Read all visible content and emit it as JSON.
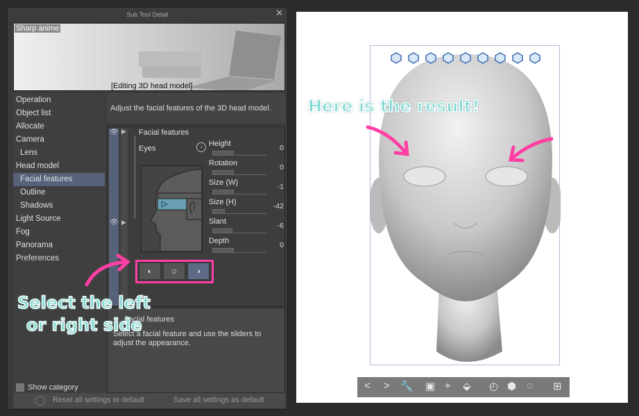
{
  "dialog": {
    "title": "Sub Tool Detail",
    "preset_name": "Sharp anime",
    "preview_caption": "[Editing 3D head model]"
  },
  "nav": {
    "items": [
      {
        "label": "Operation",
        "level": 0,
        "selected": false
      },
      {
        "label": "Object list",
        "level": 0,
        "selected": false
      },
      {
        "label": "Allocate",
        "level": 0,
        "selected": false
      },
      {
        "label": "Camera",
        "level": 0,
        "selected": false
      },
      {
        "label": "Lens",
        "level": 1,
        "selected": false
      },
      {
        "label": "Head model",
        "level": 0,
        "selected": false
      },
      {
        "label": "Facial features",
        "level": 1,
        "selected": true
      },
      {
        "label": "Outline",
        "level": 1,
        "selected": false
      },
      {
        "label": "Shadows",
        "level": 1,
        "selected": false
      },
      {
        "label": "Light Source",
        "level": 0,
        "selected": false
      },
      {
        "label": "Fog",
        "level": 0,
        "selected": false
      },
      {
        "label": "Panorama",
        "level": 0,
        "selected": false
      },
      {
        "label": "Preferences",
        "level": 0,
        "selected": false
      }
    ],
    "show_category": "Show category"
  },
  "description": "Adjust the facial features of the 3D head model.",
  "settings": {
    "section": "Facial features",
    "feature": "Eyes",
    "sliders": [
      {
        "label": "Height",
        "value": "0",
        "fraction": 0.5
      },
      {
        "label": "Rotation",
        "value": "0",
        "fraction": 0.5
      },
      {
        "label": "Size (W)",
        "value": "-1",
        "fraction": 0.49
      },
      {
        "label": "Size (H)",
        "value": "-42",
        "fraction": 0.29
      },
      {
        "label": "Slant",
        "value": "-6",
        "fraction": 0.47
      },
      {
        "label": "Depth",
        "value": "0",
        "fraction": 0.5
      }
    ],
    "side_buttons": [
      "left-side",
      "both-sides",
      "right-side"
    ],
    "selected_side": "right-side"
  },
  "help": {
    "title": "Facial features",
    "text": "Select a facial feature and use the sliders to adjust the appearance."
  },
  "footer": {
    "reset": "Reset all settings to default",
    "save": "Save all settings as default"
  },
  "annotations": {
    "result": "Here is the result!",
    "select_line1": "Select the left",
    "select_line2": "or right side",
    "accent": "#ff3fa4",
    "text_color": "#7ed8d0"
  },
  "colors": {
    "selected_nav": "#56627a",
    "panel": "#3a3a3a",
    "highlight_box": "#ff3fa4"
  }
}
